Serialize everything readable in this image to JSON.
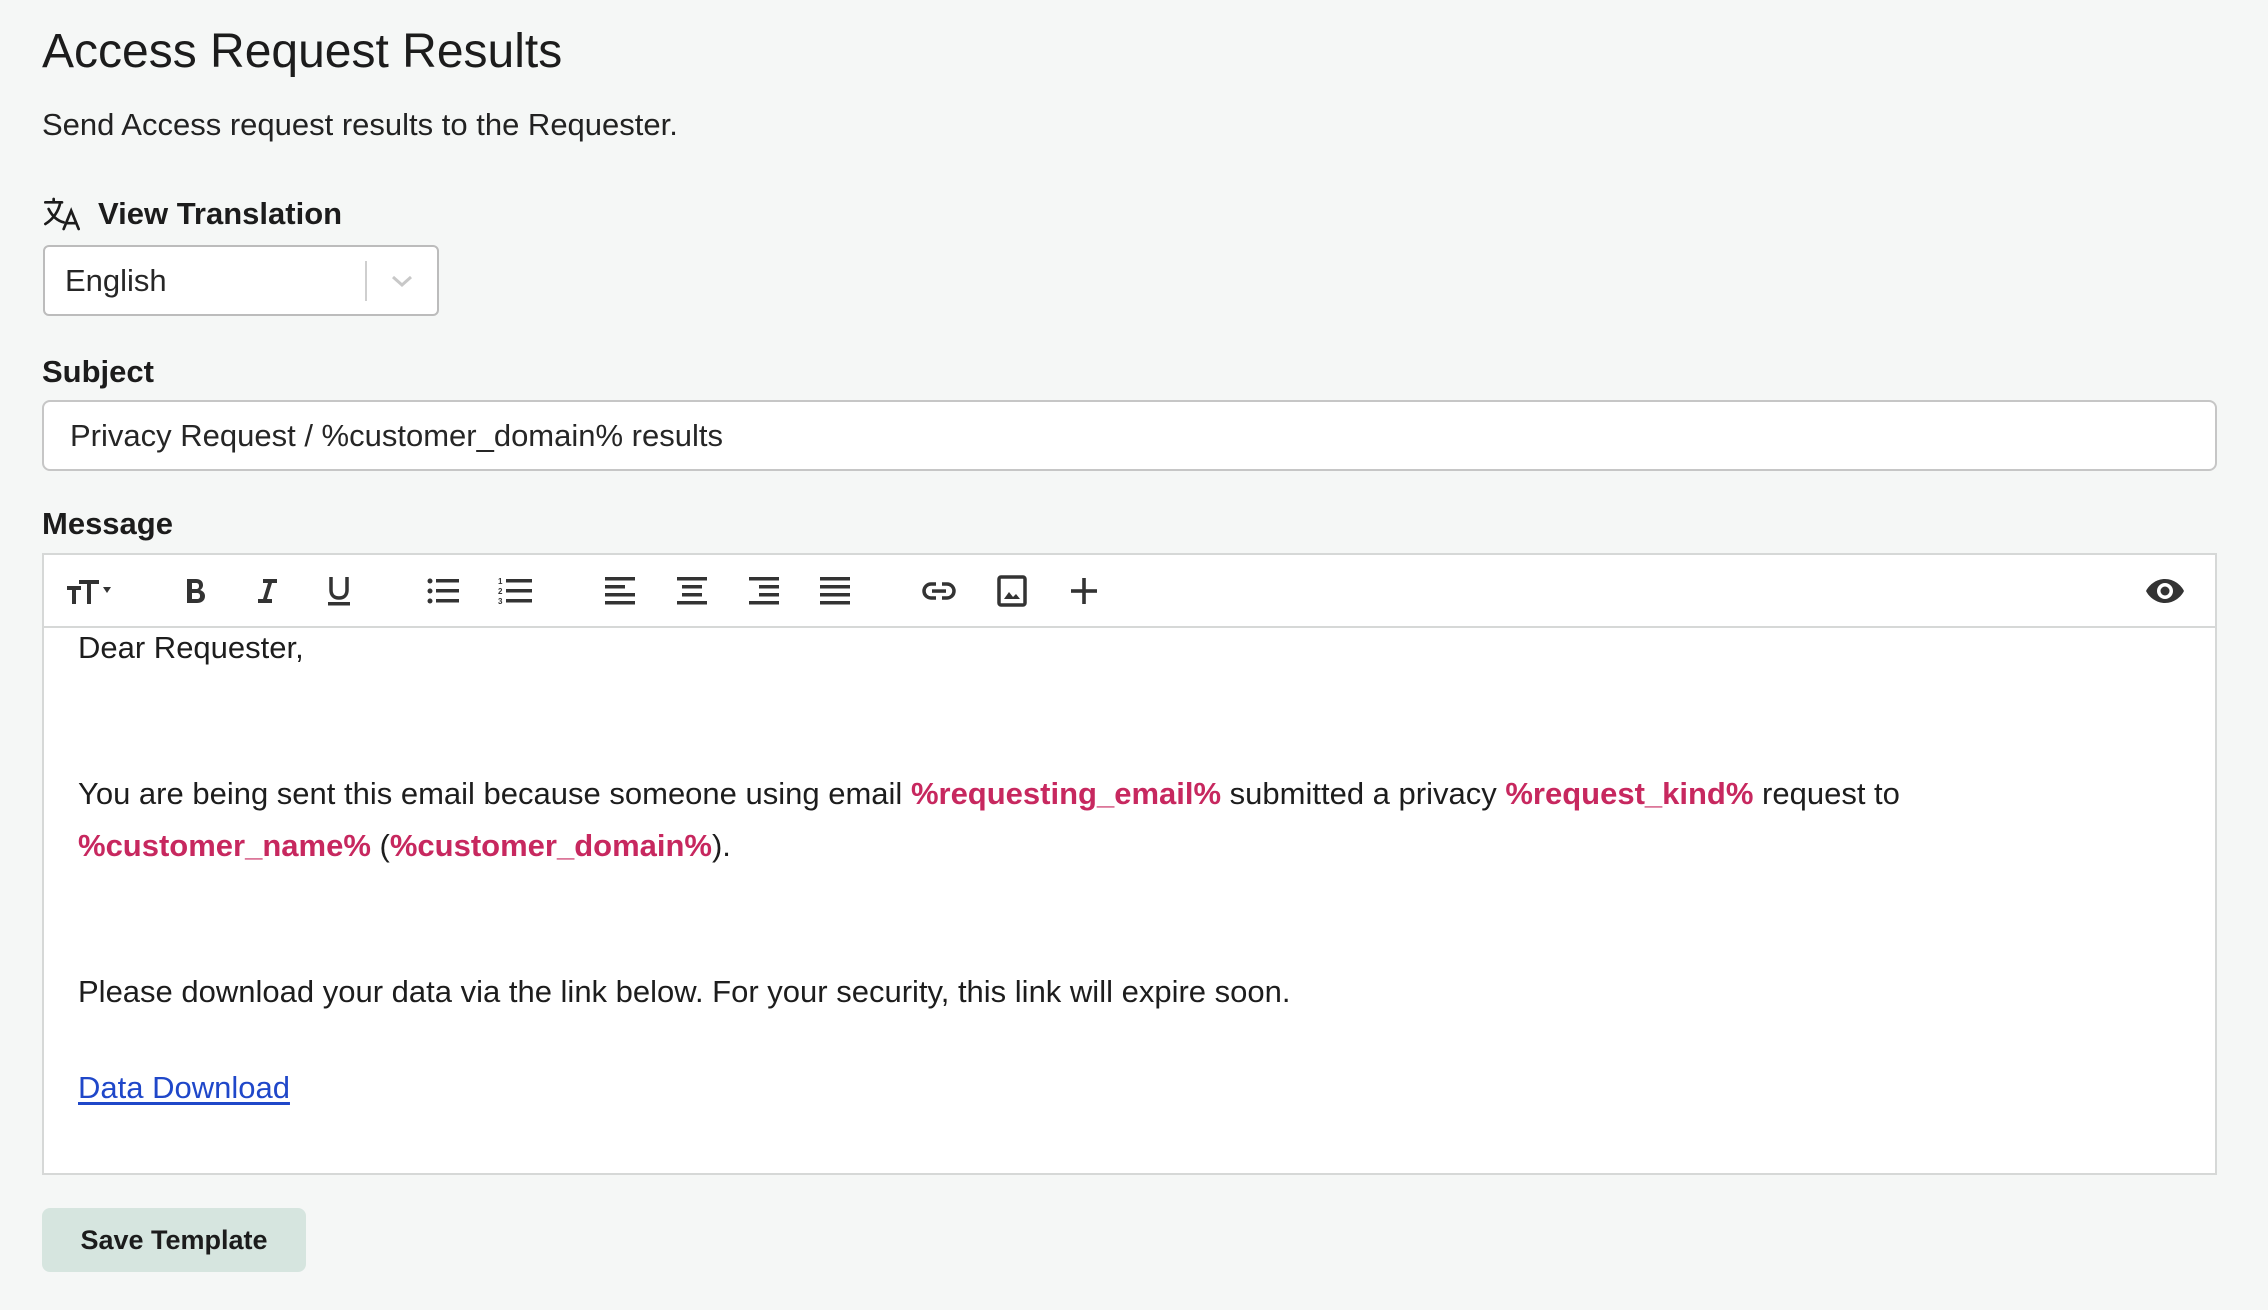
{
  "page": {
    "title": "Access Request Results",
    "subtitle": "Send Access request results to the Requester."
  },
  "translation": {
    "label": "View Translation",
    "icon": "translate-icon",
    "selected_language": "English"
  },
  "subject": {
    "label": "Subject",
    "value": "Privacy Request / %customer_domain% results"
  },
  "message": {
    "label": "Message",
    "toolbar": [
      {
        "name": "font-size-icon",
        "tooltip": "Font size"
      },
      {
        "name": "bold-icon",
        "tooltip": "Bold"
      },
      {
        "name": "italic-icon",
        "tooltip": "Italic"
      },
      {
        "name": "underline-icon",
        "tooltip": "Underline"
      },
      {
        "name": "bullet-list-icon",
        "tooltip": "Bulleted list"
      },
      {
        "name": "numbered-list-icon",
        "tooltip": "Numbered list"
      },
      {
        "name": "align-left-icon",
        "tooltip": "Align left"
      },
      {
        "name": "align-center-icon",
        "tooltip": "Align center"
      },
      {
        "name": "align-right-icon",
        "tooltip": "Align right"
      },
      {
        "name": "align-justify-icon",
        "tooltip": "Justify"
      },
      {
        "name": "link-icon",
        "tooltip": "Insert link"
      },
      {
        "name": "image-icon",
        "tooltip": "Insert image"
      },
      {
        "name": "plus-icon",
        "tooltip": "Insert"
      },
      {
        "name": "eye-icon",
        "tooltip": "Preview"
      }
    ],
    "body": {
      "greeting": "Dear Requester,",
      "p1_text1": "You are being sent this email because someone using email ",
      "p1_var1": "%requesting_email%",
      "p1_text2": " submitted a privacy ",
      "p1_var2": "%request_kind%",
      "p1_text3": " request to",
      "p1_var3": "%customer_name%",
      "p1_text4": " (",
      "p1_var4": "%customer_domain%",
      "p1_text5": ").",
      "p2": "Please download your data via the link below. For your security, this link will expire soon.",
      "link_text": "Data Download"
    }
  },
  "actions": {
    "save_label": "Save Template"
  },
  "colors": {
    "variable": "#c7285f",
    "link": "#1f47c9",
    "save_button": "#d6e5df",
    "background": "#f5f7f6"
  }
}
